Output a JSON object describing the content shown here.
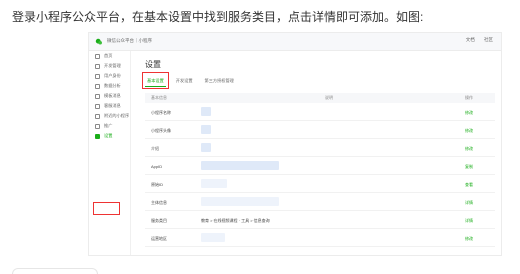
{
  "intro": "登录小程序公众平台，在基本设置中找到服务类目，点击详情即可添加。如图:",
  "topbar": {
    "title": "微信公众平台｜小程序",
    "links": [
      "文档",
      "社区"
    ]
  },
  "sidebar": {
    "items": [
      {
        "label": "首页",
        "icon": "home-icon"
      },
      {
        "label": "开发管理",
        "icon": "code-icon"
      },
      {
        "label": "用户身份",
        "icon": "user-icon"
      },
      {
        "label": "数据分析",
        "icon": "chart-icon"
      },
      {
        "label": "模板消息",
        "icon": "message-icon"
      },
      {
        "label": "客服消息",
        "icon": "service-icon"
      },
      {
        "label": "附近的小程序",
        "icon": "location-icon"
      },
      {
        "label": "推广",
        "icon": "promote-icon"
      },
      {
        "label": "设置",
        "icon": "settings-icon",
        "active": true
      }
    ]
  },
  "content": {
    "title": "设置",
    "tabs": [
      "基本设置",
      "开发设置",
      "第三方授权管理"
    ]
  },
  "table": {
    "headers": [
      "基本信息",
      "说明",
      "操作"
    ],
    "rows": [
      {
        "name": "小程序名称",
        "value": "",
        "note": "",
        "action": "修改"
      },
      {
        "name": "小程序头像",
        "value": "",
        "note": "",
        "action": "修改"
      },
      {
        "name": "介绍",
        "value": "",
        "note": "",
        "action": "修改"
      },
      {
        "name": "AppID",
        "value": "",
        "note": "",
        "action": "复制"
      },
      {
        "name": "原始ID",
        "value": "",
        "note": "",
        "action": "查看"
      },
      {
        "name": "主体信息",
        "value": "",
        "note": "",
        "action": "详情"
      },
      {
        "name": "服务类目",
        "value": "教育 > 在线视频课程 · 工具 > 信息查询",
        "note": "",
        "action": "详情"
      },
      {
        "name": "运营地区",
        "value": "",
        "note": "",
        "action": "修改"
      }
    ]
  },
  "footer": {
    "button_label": ""
  }
}
